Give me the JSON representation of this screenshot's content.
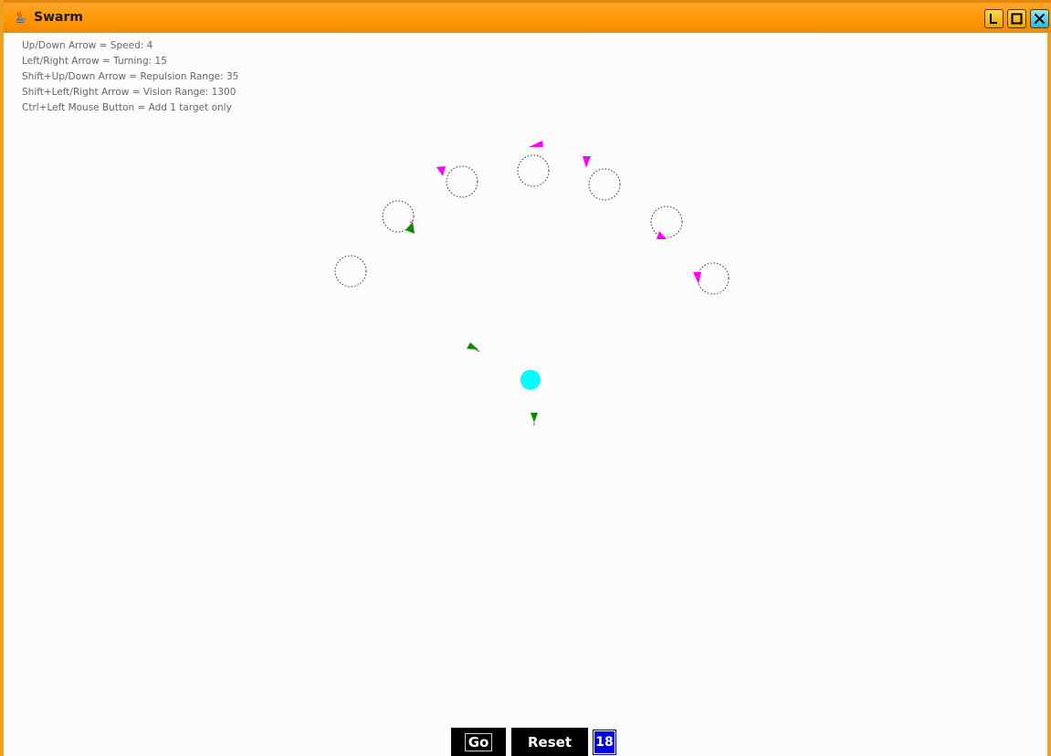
{
  "window": {
    "title": "Swarm",
    "title_icon": "java-cup-icon"
  },
  "help": {
    "line1": "Up/Down Arrow = Speed: 4",
    "line2": "Left/Right Arrow = Turning: 15",
    "line3": "Shift+Up/Down Arrow = Repulsion Range: 35",
    "line4": "Shift+Left/Right Arrow = Vision Range: 1300",
    "line5": "Ctrl+Left Mouse Button = Add 1 target only"
  },
  "controls": {
    "go_label": "Go",
    "reset_label": "Reset",
    "count": "18"
  },
  "colors": {
    "titlebar": "#ff9a10",
    "agent_magenta": "#ff00ff",
    "agent_green": "#0a8a0a",
    "target": "#00ffff",
    "count_badge": "#0000ee"
  }
}
